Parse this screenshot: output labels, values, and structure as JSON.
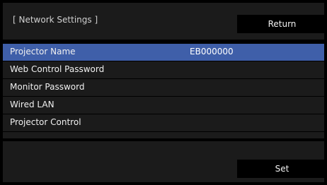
{
  "header": {
    "title": "[ Network Settings ]",
    "return_label": "Return"
  },
  "menu": {
    "items": [
      {
        "label": "Projector Name",
        "value": "EB000000",
        "selected": true
      },
      {
        "label": "Web Control Password",
        "value": ""
      },
      {
        "label": "Monitor Password",
        "value": ""
      },
      {
        "label": "Wired LAN",
        "value": ""
      },
      {
        "label": "Projector Control",
        "value": ""
      }
    ]
  },
  "footer": {
    "set_label": "Set"
  },
  "colors": {
    "background": "#000000",
    "panel": "#1b1b1b",
    "selection": "#3f5fa9",
    "button": "#000000",
    "text": "#f0f0f0"
  }
}
